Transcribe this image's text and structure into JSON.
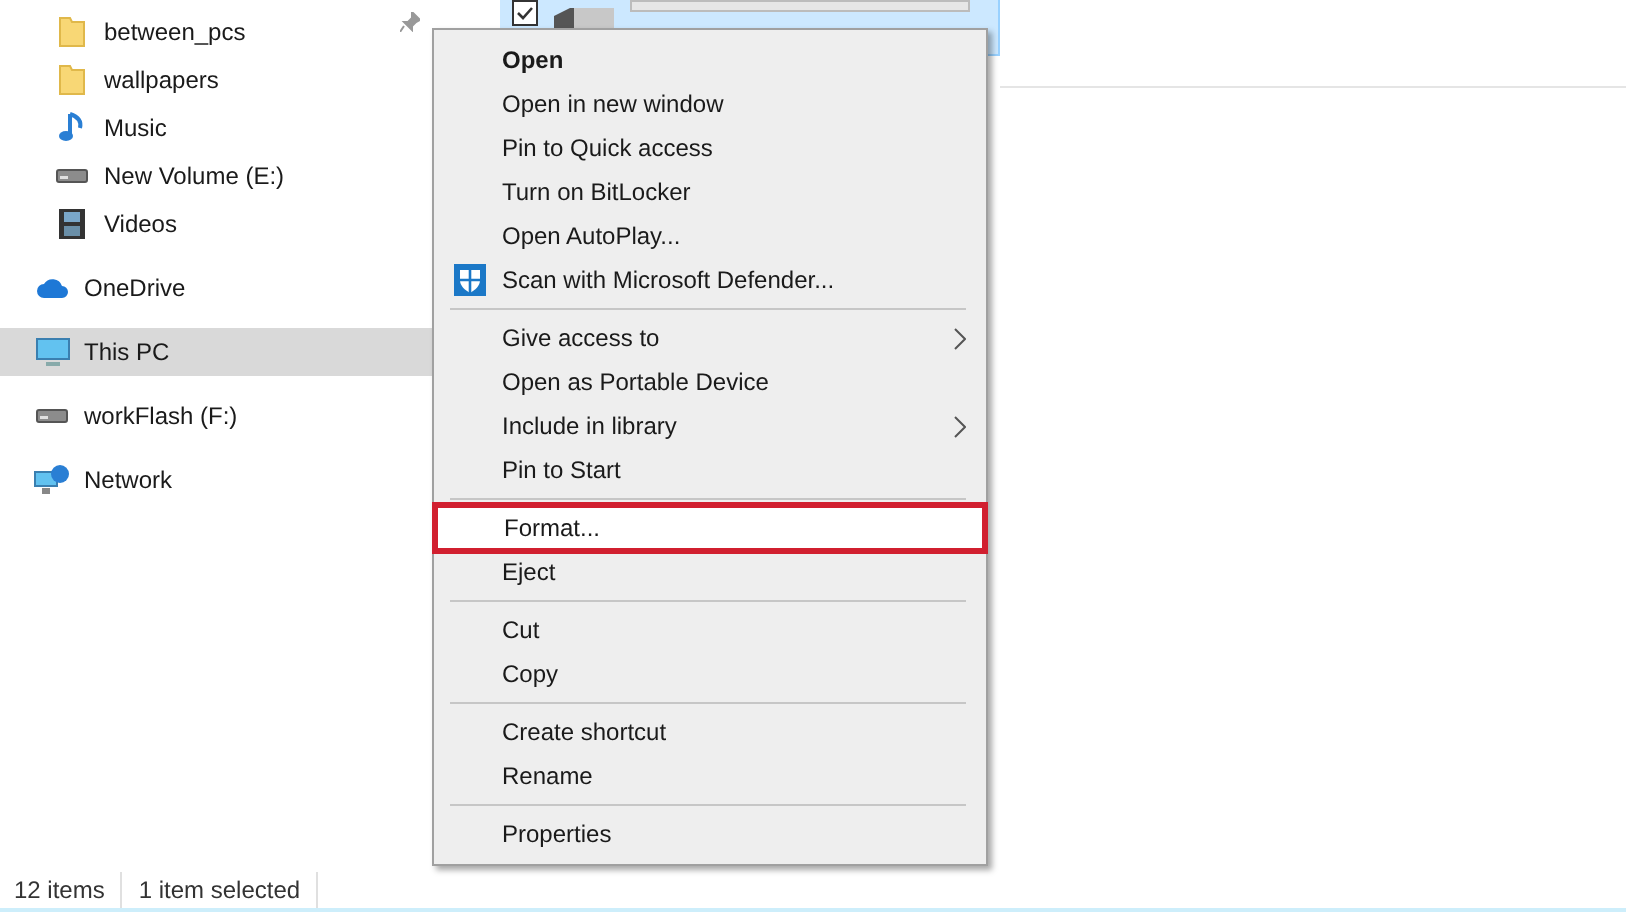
{
  "sidebar": {
    "sections": [
      {
        "indented": true,
        "items": [
          {
            "label": "between_pcs",
            "kind": "folder",
            "pinned": true,
            "selected": false
          },
          {
            "label": "wallpapers",
            "kind": "folder",
            "pinned": false,
            "selected": false
          },
          {
            "label": "Music",
            "kind": "music",
            "pinned": false,
            "selected": false
          },
          {
            "label": "New Volume (E:)",
            "kind": "drive",
            "pinned": false,
            "selected": false
          },
          {
            "label": "Videos",
            "kind": "videos",
            "pinned": false,
            "selected": false
          }
        ]
      },
      {
        "indented": false,
        "items": [
          {
            "label": "OneDrive",
            "kind": "cloud",
            "pinned": false,
            "selected": false
          }
        ]
      },
      {
        "indented": false,
        "items": [
          {
            "label": "This PC",
            "kind": "pc",
            "pinned": false,
            "selected": true
          }
        ]
      },
      {
        "indented": false,
        "items": [
          {
            "label": "workFlash (F:)",
            "kind": "drive",
            "pinned": false,
            "selected": false
          }
        ]
      },
      {
        "indented": false,
        "items": [
          {
            "label": "Network",
            "kind": "network",
            "pinned": false,
            "selected": false
          }
        ]
      }
    ]
  },
  "drive_tile": {
    "selected": true,
    "checked": true
  },
  "context_menu": {
    "groups": [
      [
        {
          "label": "Open",
          "bold": true,
          "submenu": false,
          "highlighted": false
        },
        {
          "label": "Open in new window",
          "bold": false,
          "submenu": false,
          "highlighted": false
        },
        {
          "label": "Pin to Quick access",
          "bold": false,
          "submenu": false,
          "highlighted": false
        },
        {
          "label": "Turn on BitLocker",
          "bold": false,
          "submenu": false,
          "highlighted": false
        },
        {
          "label": "Open AutoPlay...",
          "bold": false,
          "submenu": false,
          "highlighted": false
        },
        {
          "label": "Scan with Microsoft Defender...",
          "bold": false,
          "submenu": false,
          "highlighted": false,
          "kind": "shield"
        }
      ],
      [
        {
          "label": "Give access to",
          "bold": false,
          "submenu": true,
          "highlighted": false
        },
        {
          "label": "Open as Portable Device",
          "bold": false,
          "submenu": false,
          "highlighted": false
        },
        {
          "label": "Include in library",
          "bold": false,
          "submenu": true,
          "highlighted": false
        },
        {
          "label": "Pin to Start",
          "bold": false,
          "submenu": false,
          "highlighted": false
        }
      ],
      [
        {
          "label": "Format...",
          "bold": false,
          "submenu": false,
          "highlighted": true
        },
        {
          "label": "Eject",
          "bold": false,
          "submenu": false,
          "highlighted": false
        }
      ],
      [
        {
          "label": "Cut",
          "bold": false,
          "submenu": false,
          "highlighted": false
        },
        {
          "label": "Copy",
          "bold": false,
          "submenu": false,
          "highlighted": false
        }
      ],
      [
        {
          "label": "Create shortcut",
          "bold": false,
          "submenu": false,
          "highlighted": false
        },
        {
          "label": "Rename",
          "bold": false,
          "submenu": false,
          "highlighted": false
        }
      ],
      [
        {
          "label": "Properties",
          "bold": false,
          "submenu": false,
          "highlighted": false
        }
      ]
    ]
  },
  "status_bar": [
    "12 items",
    "1 item selected"
  ]
}
